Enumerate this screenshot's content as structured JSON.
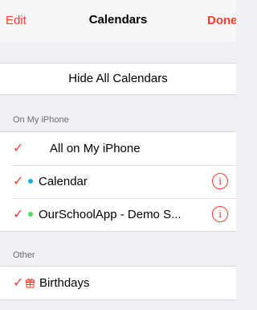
{
  "navbar": {
    "edit_label": "Edit",
    "title": "Calendars",
    "done_label": "Done"
  },
  "hide_all": {
    "label": "Hide All Calendars"
  },
  "sections": {
    "on_my_iphone": {
      "header": "On My iPhone",
      "items": [
        {
          "label": "All on My iPhone",
          "checked": true,
          "check_glyph": "✓"
        },
        {
          "label": "Calendar",
          "checked": true,
          "check_glyph": "✓",
          "dot_color": "#1badf8",
          "info_glyph": "i"
        },
        {
          "label": "OurSchoolApp - Demo S...",
          "checked": true,
          "check_glyph": "✓",
          "dot_color": "#4cd964",
          "info_glyph": "i"
        }
      ]
    },
    "other": {
      "header": "Other",
      "items": [
        {
          "label": "Birthdays",
          "checked": true,
          "check_glyph": "✓",
          "icon": "gift-icon"
        }
      ]
    }
  },
  "colors": {
    "accent": "#ff3b30",
    "background": "#efeff4",
    "cell": "#ffffff",
    "section_header_text": "#6d6d72"
  }
}
